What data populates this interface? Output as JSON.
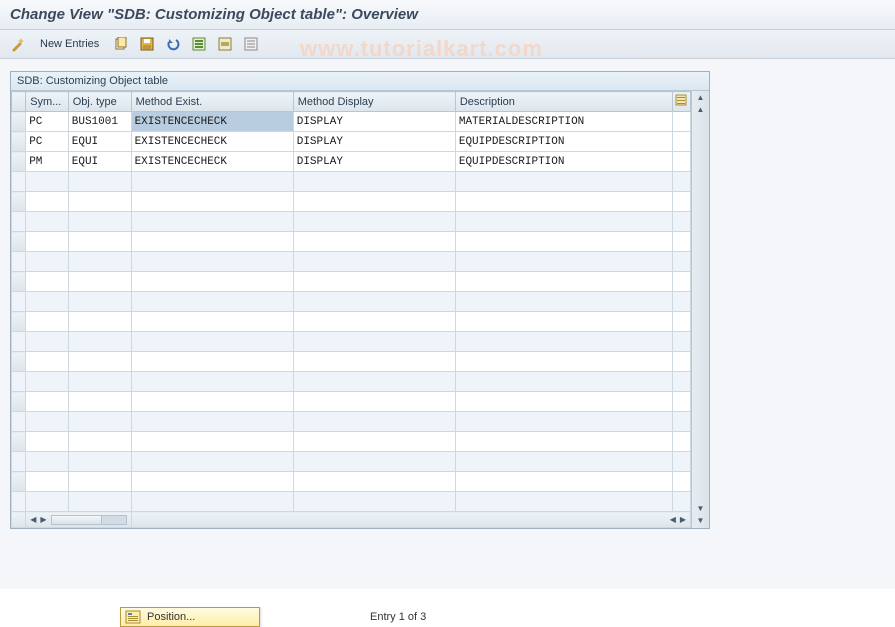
{
  "header": {
    "title": "Change View \"SDB: Customizing Object table\": Overview"
  },
  "toolbar": {
    "new_entries_label": "New Entries",
    "icons": [
      "wand-icon",
      "copy-icon",
      "save-icon",
      "undo-icon",
      "select-all-icon",
      "select-block-icon",
      "deselect-icon"
    ]
  },
  "watermark": "www.tutorialkart.com",
  "table": {
    "title": "SDB: Customizing Object table",
    "columns": [
      {
        "key": "sym",
        "label": "Sym..."
      },
      {
        "key": "obj",
        "label": "Obj. type"
      },
      {
        "key": "mex",
        "label": "Method Exist."
      },
      {
        "key": "mdi",
        "label": "Method Display"
      },
      {
        "key": "des",
        "label": "Description"
      }
    ],
    "rows": [
      {
        "sym": "PC",
        "obj": "BUS1001",
        "mex": "EXISTENCECHECK",
        "mdi": "DISPLAY",
        "des": "MATERIALDESCRIPTION"
      },
      {
        "sym": "PC",
        "obj": "EQUI",
        "mex": "EXISTENCECHECK",
        "mdi": "DISPLAY",
        "des": "EQUIPDESCRIPTION"
      },
      {
        "sym": "PM",
        "obj": "EQUI",
        "mex": "EXISTENCECHECK",
        "mdi": "DISPLAY",
        "des": "EQUIPDESCRIPTION"
      }
    ],
    "empty_row_count": 17
  },
  "footer": {
    "position_label": "Position...",
    "entry_status": "Entry 1 of 3"
  }
}
